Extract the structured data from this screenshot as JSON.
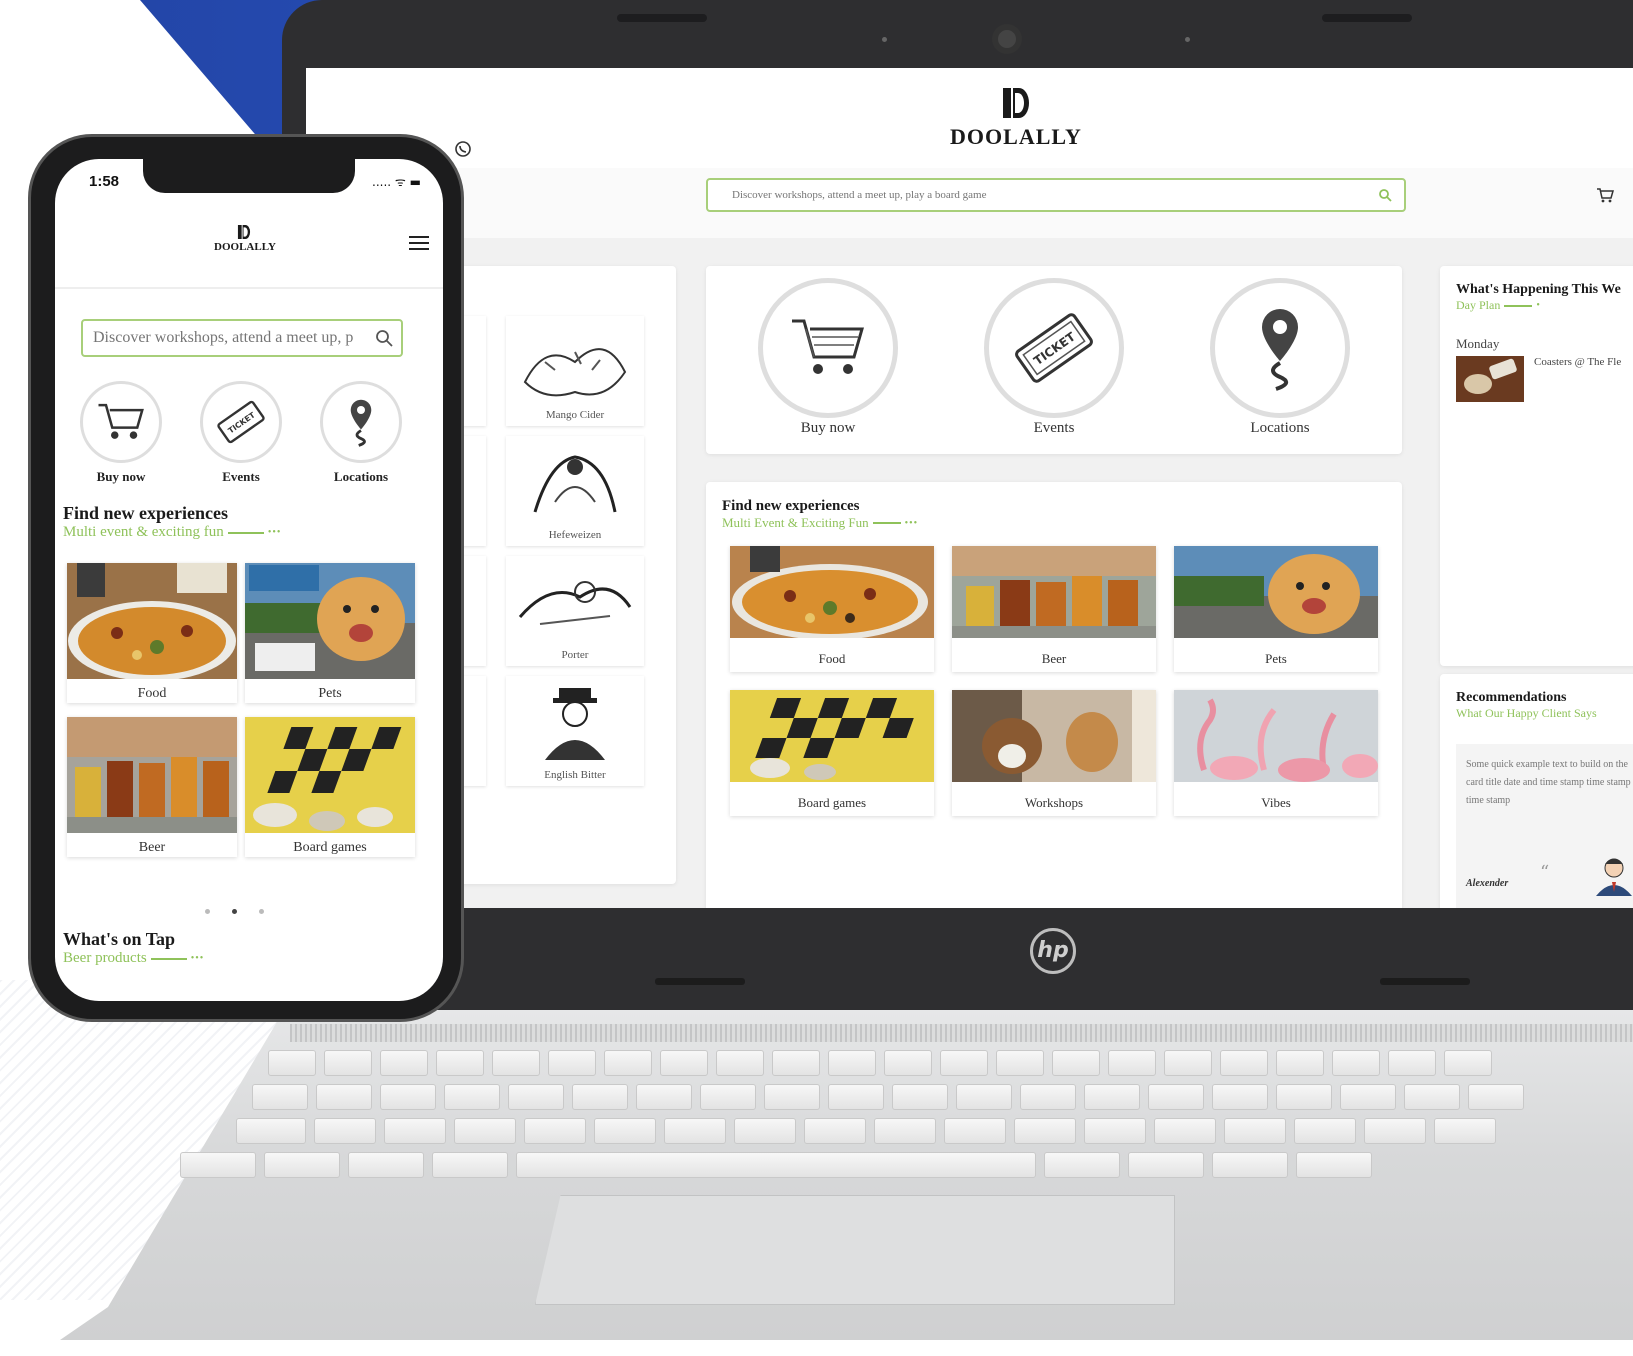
{
  "brand": {
    "name": "DOOLALLY",
    "accent_color": "#8fc25a"
  },
  "desktop": {
    "search": {
      "placeholder": "Discover workshops, attend a meet up, play a board game"
    },
    "quick_links": [
      {
        "label": "Buy now",
        "icon": "cart-icon"
      },
      {
        "label": "Events",
        "icon": "ticket-icon"
      },
      {
        "label": "Locations",
        "icon": "location-pin-icon"
      }
    ],
    "on_tap": [
      {
        "label": "Mango Cider"
      },
      {
        "label": "Hefeweizen"
      },
      {
        "label": "Porter"
      },
      {
        "label": "English Bitter"
      }
    ],
    "experiences": {
      "title": "Find new experiences",
      "subtitle": "Multi Event & Exciting Fun",
      "items": [
        {
          "label": "Food"
        },
        {
          "label": "Beer"
        },
        {
          "label": "Pets"
        },
        {
          "label": "Board games"
        },
        {
          "label": "Workshops"
        },
        {
          "label": "Vibes"
        }
      ]
    },
    "happening": {
      "title": "What's Happening This We",
      "subtitle": "Day Plan",
      "day": "Monday",
      "event": "Coasters @ The Fle"
    },
    "recommendations": {
      "title": "Recommendations",
      "subtitle": "What Our Happy Client Says",
      "quote": "Some quick example text to build on the card title date and time stamp time stamp time stamp",
      "author": "Alexender"
    }
  },
  "mobile": {
    "time": "1:58",
    "status": "..... ᯤ ▬",
    "search": {
      "placeholder": "Discover workshops, attend a meet up, p"
    },
    "quick_links": [
      {
        "label": "Buy now"
      },
      {
        "label": "Events"
      },
      {
        "label": "Locations"
      }
    ],
    "experiences": {
      "title": "Find new experiences",
      "subtitle": "Multi event & exciting fun",
      "items": [
        {
          "label": "Food"
        },
        {
          "label": "Pets"
        },
        {
          "label": "Beer"
        },
        {
          "label": "Board games"
        }
      ]
    },
    "on_tap": {
      "title": "What's on Tap",
      "subtitle": "Beer products"
    }
  },
  "laptop": {
    "brand_mark": "hp"
  }
}
